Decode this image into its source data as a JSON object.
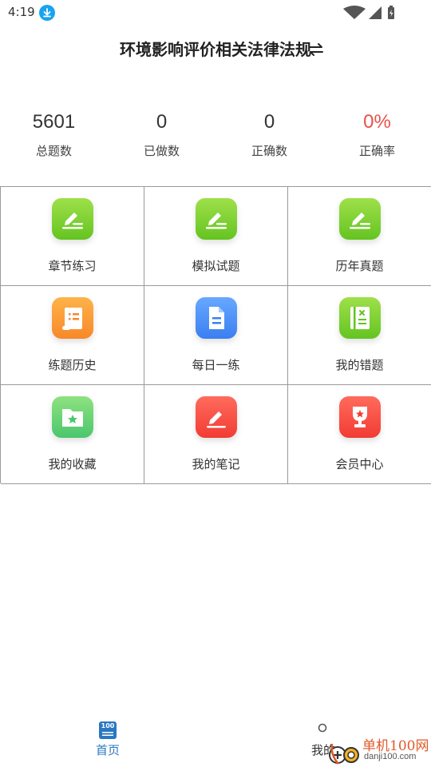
{
  "status_bar": {
    "time": "4:19"
  },
  "header": {
    "title": "环境影响评价相关法律法规"
  },
  "stats": [
    {
      "value": "5601",
      "label": "总题数"
    },
    {
      "value": "0",
      "label": "已做数"
    },
    {
      "value": "0",
      "label": "正确数"
    },
    {
      "value": "0%",
      "label": "正确率"
    }
  ],
  "grid": [
    {
      "label": "章节练习",
      "icon": "edit-icon",
      "color": "#7ed33a"
    },
    {
      "label": "模拟试题",
      "icon": "edit-icon",
      "color": "#7ed33a"
    },
    {
      "label": "历年真题",
      "icon": "edit-icon",
      "color": "#7ed33a"
    },
    {
      "label": "练题历史",
      "icon": "scroll-icon",
      "color": "#f99a35"
    },
    {
      "label": "每日一练",
      "icon": "document-icon",
      "color": "#4a8ff5"
    },
    {
      "label": "我的错题",
      "icon": "wrong-book-icon",
      "color": "#7ed33a"
    },
    {
      "label": "我的收藏",
      "icon": "star-folder-icon",
      "color": "#5fd47a"
    },
    {
      "label": "我的笔记",
      "icon": "note-pen-icon",
      "color": "#f54b3e"
    },
    {
      "label": "会员中心",
      "icon": "trophy-icon",
      "color": "#f54b3e"
    }
  ],
  "bottom_nav": {
    "home": {
      "label": "首页",
      "icon_text": "100"
    },
    "mine": {
      "label": "我的"
    }
  },
  "watermark": {
    "name": "单机100网",
    "url": "danji100.com"
  }
}
